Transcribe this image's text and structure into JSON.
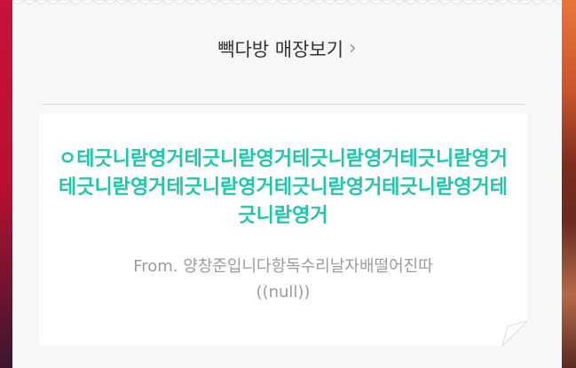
{
  "store_link": {
    "label": "빽다방 매장보기",
    "chevron": "›"
  },
  "gift_card": {
    "message": "ㅇ테긋니랃영거테긋니랃영거테긋니랃영거테긋니랃영거테긋니랃영거테긋니랃영거테긋니랃영거테긋니랃영거테긋니랃영거",
    "from_line": "From. 양창준입니다항독수리날자배떨어진따",
    "from_sub": "((null))"
  },
  "colors": {
    "accent": "#1ec7a9",
    "muted_text": "#9b9b9b",
    "panel_bg": "#f7f7f7"
  },
  "icons": {
    "chevron": "chevron-right-icon",
    "corner": "page-fold-icon"
  }
}
